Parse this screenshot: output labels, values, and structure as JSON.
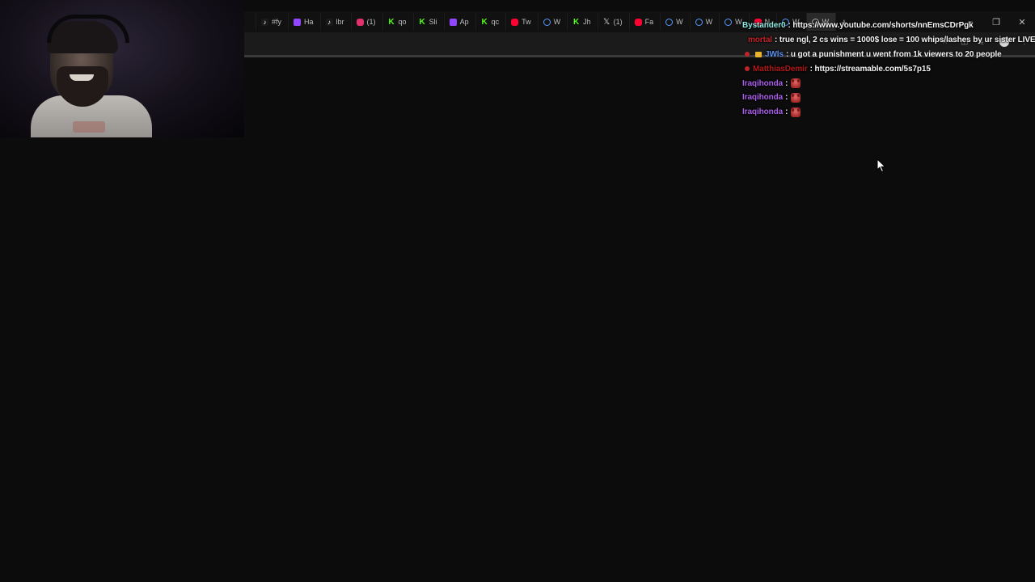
{
  "browser": {
    "tabs": [
      {
        "label": "",
        "icon": "tab-edge"
      },
      {
        "label": "#fy",
        "icon": "tiktok-icon"
      },
      {
        "label": "Ha",
        "icon": "twitch-icon"
      },
      {
        "label": "lbr",
        "icon": "tiktok-icon"
      },
      {
        "label": "(1)",
        "icon": "instagram-icon"
      },
      {
        "label": "qo",
        "icon": "kick-icon"
      },
      {
        "label": "Sli",
        "icon": "kick-icon"
      },
      {
        "label": "Ap",
        "icon": "twitch-icon"
      },
      {
        "label": "qc",
        "icon": "kick-icon"
      },
      {
        "label": "Tw",
        "icon": "youtube-icon"
      },
      {
        "label": "W",
        "icon": "web-icon"
      },
      {
        "label": "Jh",
        "icon": "kick-icon"
      },
      {
        "label": "(1)",
        "icon": "x-icon"
      },
      {
        "label": "Fa",
        "icon": "youtube-icon"
      },
      {
        "label": "W",
        "icon": "web-icon"
      },
      {
        "label": "W",
        "icon": "web-icon"
      },
      {
        "label": "W",
        "icon": "web-icon"
      },
      {
        "label": "N",
        "icon": "youtube-icon"
      },
      {
        "label": "W",
        "icon": "web-icon"
      },
      {
        "label": "W",
        "icon": "google-icon"
      }
    ],
    "new_tab_label": "+",
    "window_controls": {
      "minimize": "–",
      "restore": "❐",
      "close": "✕"
    }
  },
  "chat": {
    "messages": [
      {
        "user": "Bystander0",
        "user_color": "#8ee6e0",
        "badge": "",
        "text": "https://www.youtube.com/shorts/nnEmsCDrPgk"
      },
      {
        "user": "mortal",
        "user_color": "#c0242a",
        "badge": "red",
        "text": "true ngl, 2 cs wins = 1000$ lose = 100 whips/lashes by ur sister LIVE"
      },
      {
        "user": "JWls",
        "user_color": "#5a8ff0",
        "badge": "sub",
        "text": "u got a punishment u went from 1k viewers to 20 people"
      },
      {
        "user": "MatthiasDemir",
        "user_color": "#b01818",
        "badge": "red",
        "text": "https://streamable.com/5s7p15"
      },
      {
        "user": "Iraqihonda",
        "user_color": "#a95ee8",
        "badge": "",
        "text": "",
        "emote": "red-face-emote"
      },
      {
        "user": "Iraqihonda",
        "user_color": "#a95ee8",
        "badge": "",
        "text": "",
        "emote": "red-face-emote"
      },
      {
        "user": "Iraqihonda",
        "user_color": "#a95ee8",
        "badge": "",
        "text": "",
        "emote": "red-face-emote"
      }
    ],
    "separator": ":"
  }
}
